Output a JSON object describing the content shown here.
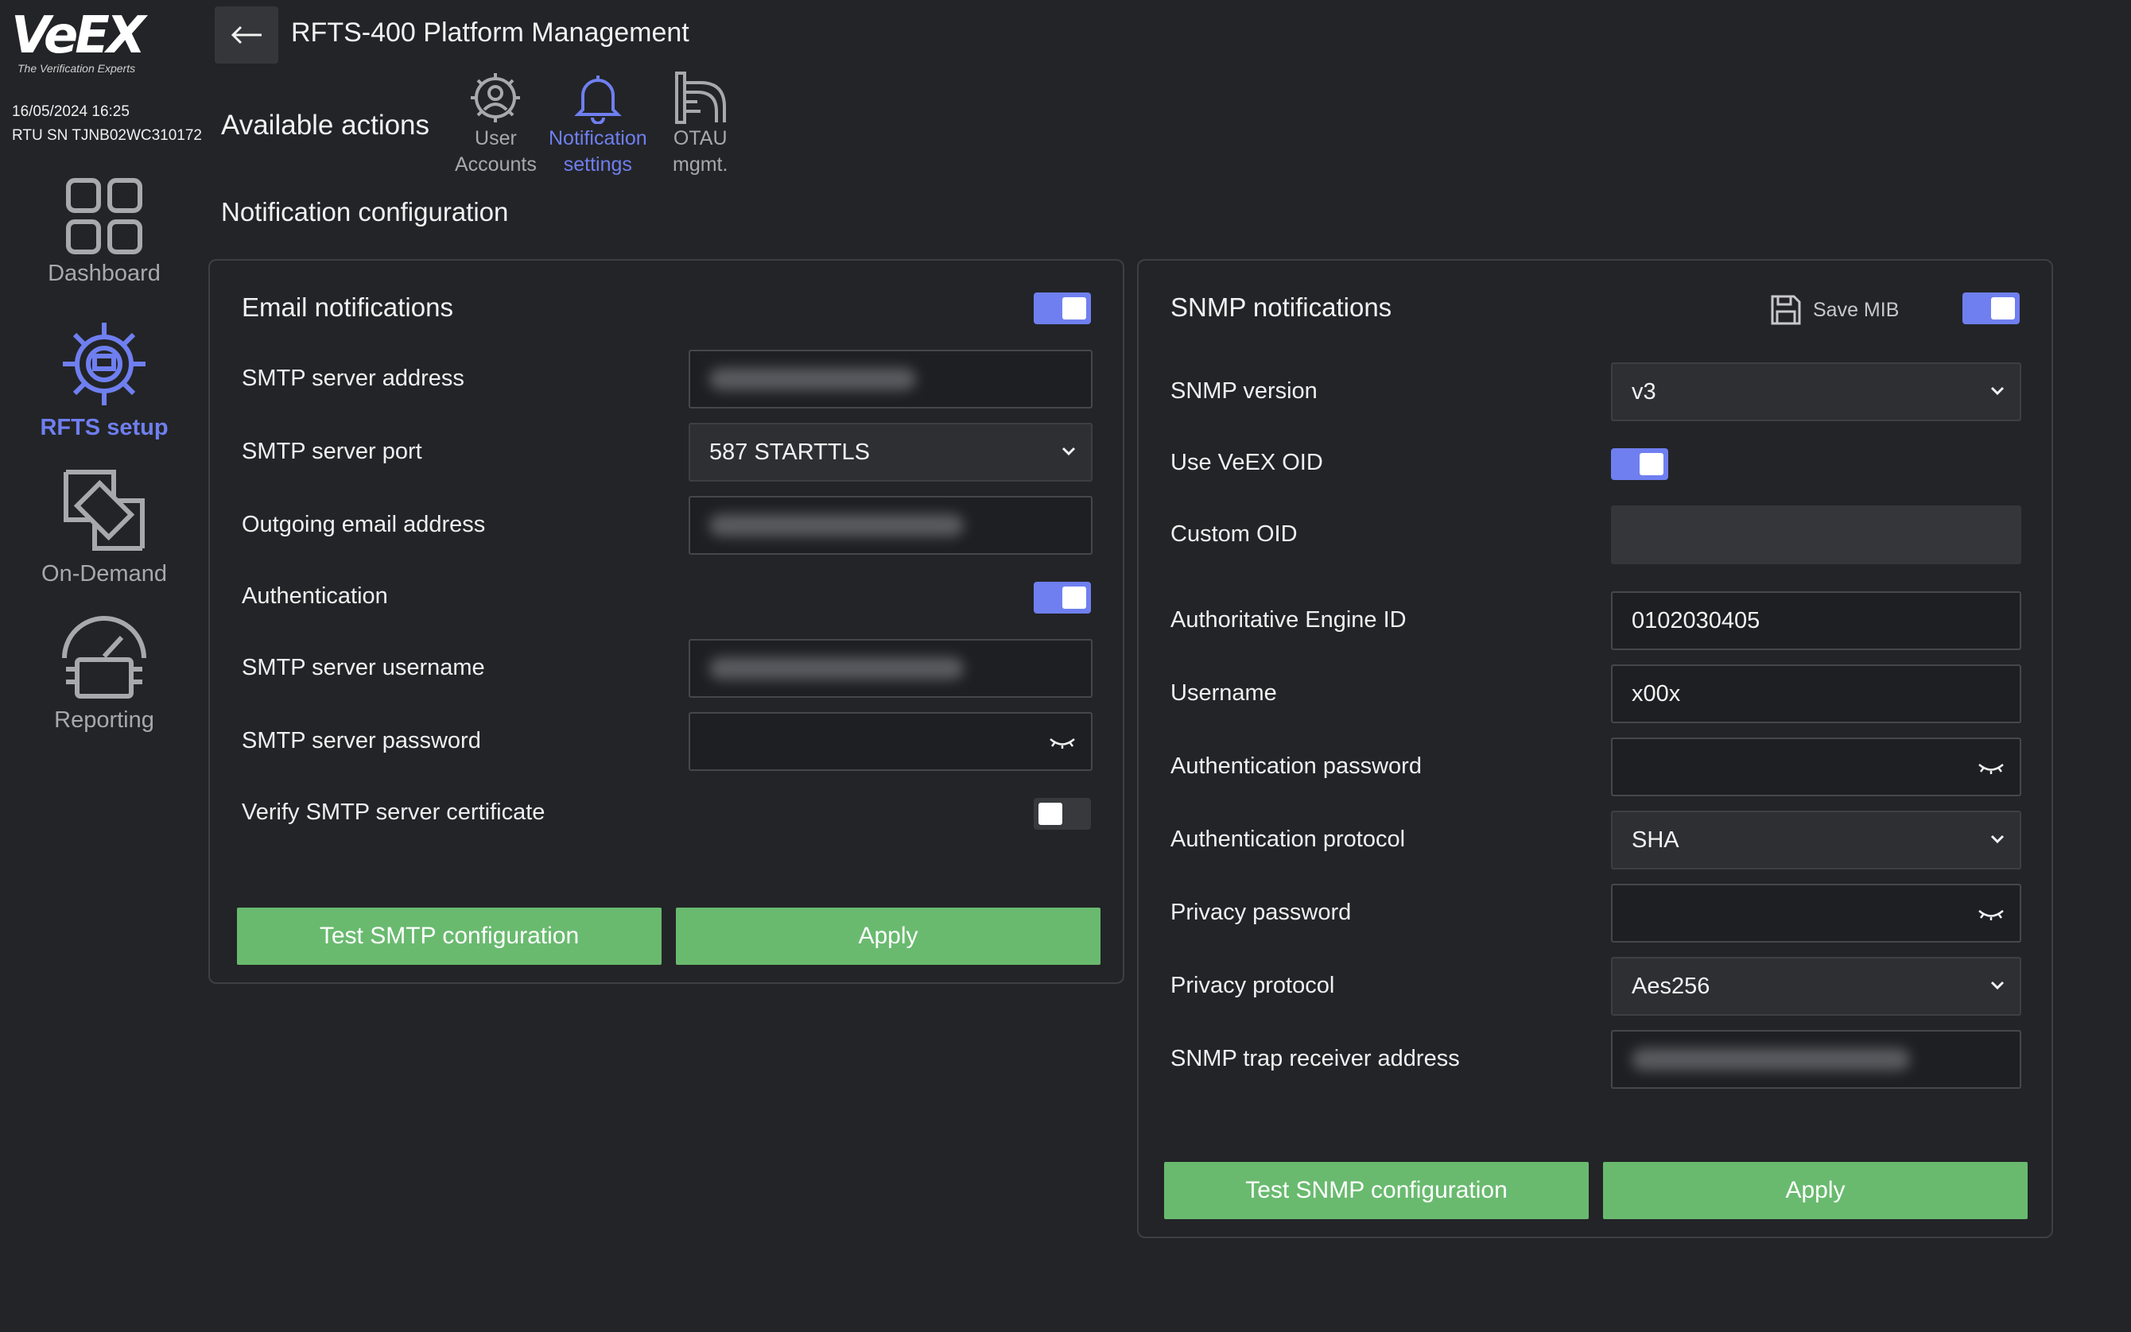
{
  "brand": {
    "logo": "VeEX",
    "tagline": "The Verification Experts"
  },
  "meta": {
    "datetime": "16/05/2024 16:25",
    "serial": "RTU SN TJNB02WC310172"
  },
  "sidebar": {
    "items": [
      {
        "label": "Dashboard",
        "icon": "dashboard-grid-icon",
        "active": false
      },
      {
        "label": "RFTS setup",
        "icon": "gear-icon",
        "active": true
      },
      {
        "label": "On-Demand",
        "icon": "on-demand-icon",
        "active": false
      },
      {
        "label": "Reporting",
        "icon": "gauge-icon",
        "active": false
      }
    ]
  },
  "header": {
    "title": "RFTS-400 Platform Management"
  },
  "actions": {
    "label": "Available actions",
    "items": [
      {
        "line1": "User",
        "line2": "Accounts",
        "icon": "user-gear-icon",
        "active": false
      },
      {
        "line1": "Notification",
        "line2": "settings",
        "icon": "bell-icon",
        "active": true
      },
      {
        "line1": "OTAU",
        "line2": "mgmt.",
        "icon": "otau-switch-icon",
        "active": false
      }
    ]
  },
  "section_title": "Notification configuration",
  "email": {
    "title": "Email notifications",
    "enabled": true,
    "smtp_address_label": "SMTP server address",
    "smtp_port_label": "SMTP server port",
    "smtp_port_value": "587 STARTTLS",
    "outgoing_label": "Outgoing email address",
    "auth_label": "Authentication",
    "auth_enabled": true,
    "username_label": "SMTP server username",
    "password_label": "SMTP server password",
    "verify_label": "Verify SMTP server certificate",
    "verify_enabled": false,
    "test_button": "Test SMTP configuration",
    "apply_button": "Apply"
  },
  "snmp": {
    "title": "SNMP notifications",
    "save_mib": "Save MIB",
    "enabled": true,
    "version_label": "SNMP version",
    "version_value": "v3",
    "use_oid_label": "Use VeEX OID",
    "use_oid_enabled": true,
    "custom_oid_label": "Custom OID",
    "engine_id_label": "Authoritative Engine ID",
    "engine_id_value": "0102030405",
    "username_label": "Username",
    "username_value": "x00x",
    "auth_password_label": "Authentication password",
    "auth_protocol_label": "Authentication protocol",
    "auth_protocol_value": "SHA",
    "privacy_password_label": "Privacy password",
    "privacy_protocol_label": "Privacy protocol",
    "privacy_protocol_value": "Aes256",
    "trap_receiver_label": "SNMP trap receiver address",
    "test_button": "Test SNMP configuration",
    "apply_button": "Apply"
  },
  "colors": {
    "accent": "#6f7ff0",
    "button_green": "#69ba6f",
    "background": "#232427"
  }
}
